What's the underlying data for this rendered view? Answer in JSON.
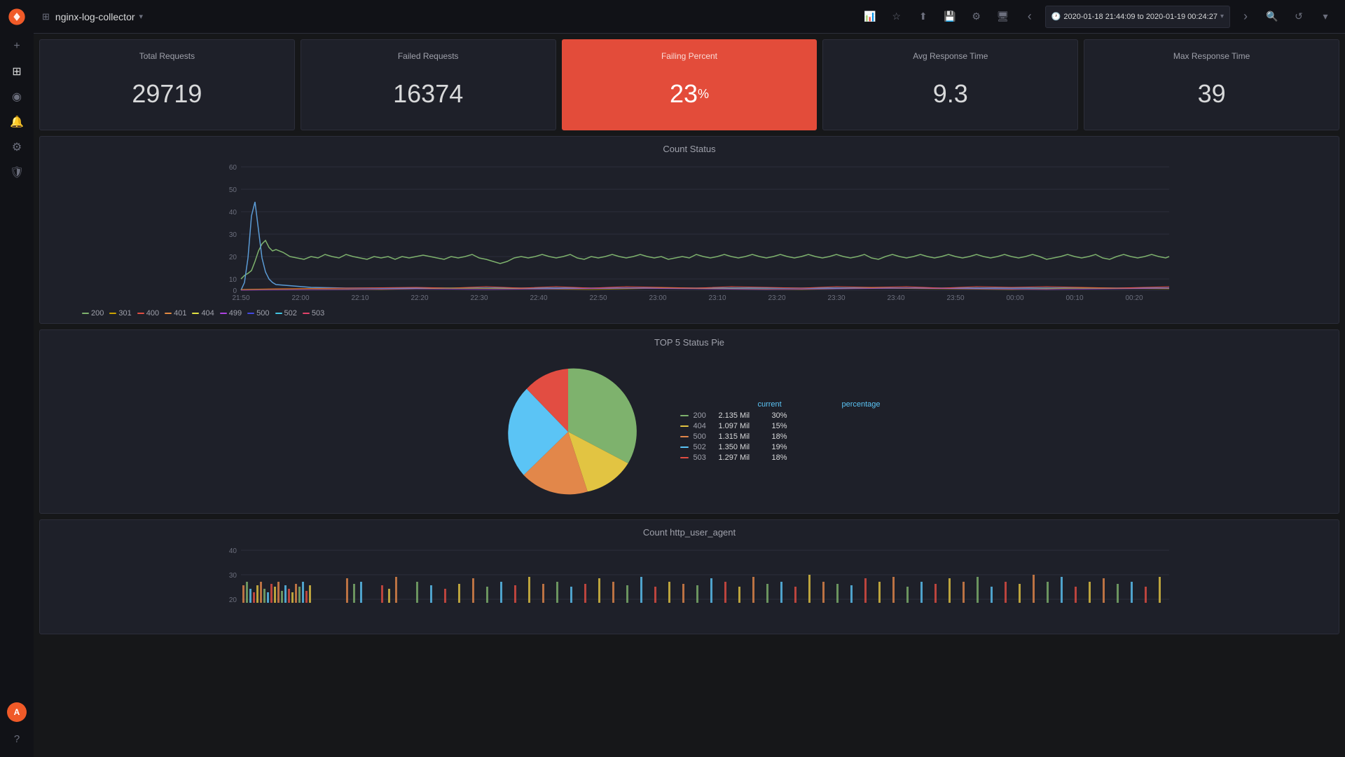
{
  "app": {
    "title": "nginx-log-collector",
    "timeRange": "2020-01-18 21:44:09 to 2020-01-19 00:24:27"
  },
  "sidebar": {
    "items": [
      {
        "name": "add-icon",
        "symbol": "+"
      },
      {
        "name": "dashboard-icon",
        "symbol": "⊞"
      },
      {
        "name": "explore-icon",
        "symbol": "◎"
      },
      {
        "name": "alert-icon",
        "symbol": "🔔"
      },
      {
        "name": "settings-icon",
        "symbol": "⚙"
      },
      {
        "name": "shield-icon",
        "symbol": "🛡"
      }
    ]
  },
  "stats": {
    "totalRequests": {
      "label": "Total Requests",
      "value": "29719"
    },
    "failedRequests": {
      "label": "Failed Requests",
      "value": "16374"
    },
    "failingPercent": {
      "label": "Failing Percent",
      "value": "23",
      "unit": "%"
    },
    "avgResponseTime": {
      "label": "Avg Response Time",
      "value": "9.3"
    },
    "maxResponseTime": {
      "label": "Max Response Time",
      "value": "39"
    }
  },
  "countStatus": {
    "title": "Count Status",
    "yLabels": [
      "60",
      "50",
      "40",
      "30",
      "20",
      "10",
      "0"
    ],
    "xLabels": [
      "21:50",
      "22:00",
      "22:10",
      "22:20",
      "22:30",
      "22:40",
      "22:50",
      "23:00",
      "23:10",
      "23:20",
      "23:30",
      "23:40",
      "23:50",
      "00:00",
      "00:10",
      "00:20"
    ],
    "legend": [
      {
        "code": "200",
        "color": "#7eb26d"
      },
      {
        "code": "301",
        "color": "#cca300"
      },
      {
        "code": "400",
        "color": "#e24d42"
      },
      {
        "code": "401",
        "color": "#e28a42"
      },
      {
        "code": "404",
        "color": "#e2e242"
      },
      {
        "code": "499",
        "color": "#ae42e2"
      },
      {
        "code": "500",
        "color": "#4248e2"
      },
      {
        "code": "502",
        "color": "#42c5e2"
      },
      {
        "code": "503",
        "color": "#e2426a"
      }
    ]
  },
  "top5Pie": {
    "title": "TOP 5 Status Pie",
    "slices": [
      {
        "label": "200",
        "color": "#7eb26d",
        "percentage": 30,
        "startAngle": 0,
        "endAngle": 108
      },
      {
        "label": "404",
        "color": "#e2c442",
        "percentage": 15,
        "startAngle": 108,
        "endAngle": 162
      },
      {
        "label": "500",
        "color": "#e2874a",
        "percentage": 18,
        "startAngle": 162,
        "endAngle": 226.8
      },
      {
        "label": "502",
        "color": "#5bc4f5",
        "percentage": 19,
        "startAngle": 226.8,
        "endAngle": 295.2
      },
      {
        "label": "503",
        "color": "#e24d42",
        "percentage": 18,
        "startAngle": 295.2,
        "endAngle": 360
      }
    ],
    "legend": {
      "headers": [
        "current",
        "percentage"
      ],
      "rows": [
        {
          "label": "200",
          "color": "#7eb26d",
          "current": "2.135 Mil",
          "percentage": "30%"
        },
        {
          "label": "404",
          "color": "#e2c442",
          "current": "1.097 Mil",
          "percentage": "15%"
        },
        {
          "label": "500",
          "color": "#e2874a",
          "current": "1.315 Mil",
          "percentage": "18%"
        },
        {
          "label": "502",
          "color": "#5bc4f5",
          "current": "1.350 Mil",
          "percentage": "19%"
        },
        {
          "label": "503",
          "color": "#e24d42",
          "current": "1.297 Mil",
          "percentage": "18%"
        }
      ]
    }
  },
  "countHttpUserAgent": {
    "title": "Count http_user_agent",
    "yLabels": [
      "40",
      "30",
      "20"
    ]
  },
  "toolbar": {
    "graphIcon": "📊",
    "starIcon": "★",
    "shareIcon": "⬆",
    "saveIcon": "💾",
    "settingsIcon": "⚙",
    "monitorIcon": "🖥",
    "prevIcon": "‹",
    "nextIcon": "›",
    "zoomIcon": "🔍",
    "refreshIcon": "↺",
    "chevronIcon": "▾"
  }
}
